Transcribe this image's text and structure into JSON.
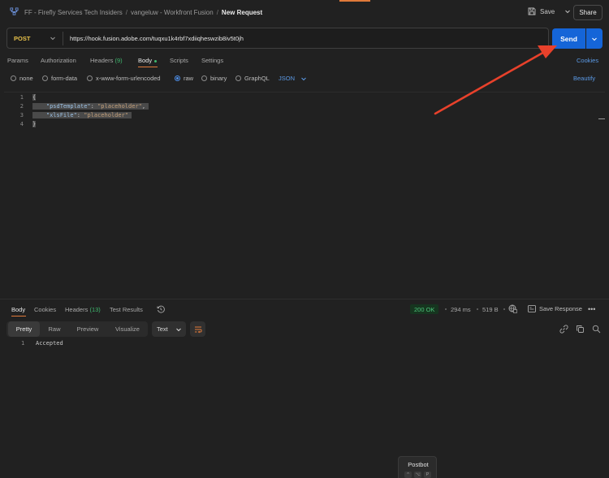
{
  "breadcrumb": {
    "workspace": "FF - Firefly Services Tech Insiders",
    "collection": "vangeluw - Workfront Fusion",
    "request": "New Request"
  },
  "header": {
    "save_label": "Save",
    "share_label": "Share"
  },
  "request": {
    "method": "POST",
    "url": "https://hook.fusion.adobe.com/tuqxu1k4rbf7xdiiqheswzib8iv5t0jh",
    "send_label": "Send"
  },
  "request_tabs": [
    {
      "label": "Params"
    },
    {
      "label": "Authorization"
    },
    {
      "label": "Headers",
      "count": "(9)"
    },
    {
      "label": "Body",
      "active": true
    },
    {
      "label": "Scripts"
    },
    {
      "label": "Settings"
    }
  ],
  "cookies_label": "Cookies",
  "body_types": [
    {
      "label": "none"
    },
    {
      "label": "form-data"
    },
    {
      "label": "x-www-form-urlencoded"
    },
    {
      "label": "raw",
      "selected": true
    },
    {
      "label": "binary"
    },
    {
      "label": "GraphQL"
    }
  ],
  "raw_language": "JSON",
  "beautify_label": "Beautify",
  "editor": {
    "line_numbers": [
      "1",
      "2",
      "3",
      "4"
    ],
    "lines": {
      "open": "{",
      "psd_key": "\"psdTemplate\"",
      "psd_value": "\"placeholder\"",
      "xls_key": "\"xlsFile\"",
      "xls_value": "\"placeholder\"",
      "close": "}"
    }
  },
  "response_tabs": [
    {
      "label": "Body",
      "active": true
    },
    {
      "label": "Cookies"
    },
    {
      "label": "Headers",
      "count": "(13)"
    },
    {
      "label": "Test Results"
    }
  ],
  "response_meta": {
    "status": "200 OK",
    "time": "294 ms",
    "size": "519 B",
    "save_response_label": "Save Response"
  },
  "response_views": [
    {
      "label": "Pretty",
      "active": true
    },
    {
      "label": "Raw"
    },
    {
      "label": "Preview"
    },
    {
      "label": "Visualize"
    }
  ],
  "response_format": "Text",
  "response_body": {
    "line_number": "1",
    "text": "Accepted"
  },
  "postbot": {
    "label": "Postbot",
    "shortcut_keys": [
      "^",
      "⌥",
      "P"
    ]
  },
  "colors": {
    "send_button": "#1565d8",
    "annotation_arrow": "#e8412b",
    "status_ok": "#4cc37a",
    "method_post": "#e8c24a"
  }
}
